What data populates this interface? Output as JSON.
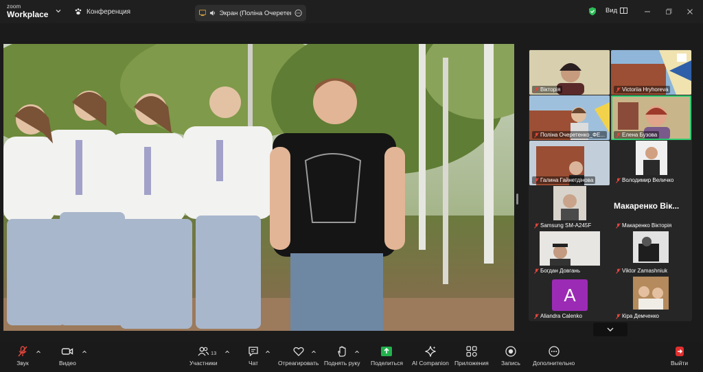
{
  "titlebar": {
    "logo_line1": "zoom",
    "logo_line2": "Workplace",
    "meeting_label": "Конференция",
    "share_label": "Экран (Поліна Очеретенко_",
    "view_label": "Вид"
  },
  "gallery": {
    "tiles": [
      {
        "name": "Вікторія"
      },
      {
        "name": "Victoriia Hryhoreva"
      },
      {
        "name": "Поліна Очеретенко_ФЕ..."
      },
      {
        "name": "Елена Бузова"
      },
      {
        "name": "Галина Гайнетдінова"
      },
      {
        "name": "Володимир Величко"
      },
      {
        "name": "Samsung SM-A245F"
      },
      {
        "name": "Макаренко Вікторія",
        "big_label": "Макаренко Вік..."
      },
      {
        "name": "Богдан Довгань"
      },
      {
        "name": "Viktor Zamashniuk"
      },
      {
        "name": "Aliandra Calenko",
        "avatar_letter": "A"
      },
      {
        "name": "Кіра Демченко"
      }
    ]
  },
  "toolbar": {
    "audio": "Звук",
    "video": "Видео",
    "participants": "Участники",
    "participants_count": "13",
    "chat": "Чат",
    "react": "Отреагировать",
    "raise_hand": "Поднять руку",
    "share": "Поделиться",
    "ai_companion": "AI Companion",
    "apps": "Приложения",
    "record": "Запись",
    "more": "Дополнительно",
    "leave": "Выйти"
  },
  "colors": {
    "active_speaker": "#2ecc71",
    "share_green": "#23b14d",
    "leave_red": "#e02f2f",
    "muted_red": "#e0463c",
    "avatar_purple": "#9b2bb5"
  }
}
